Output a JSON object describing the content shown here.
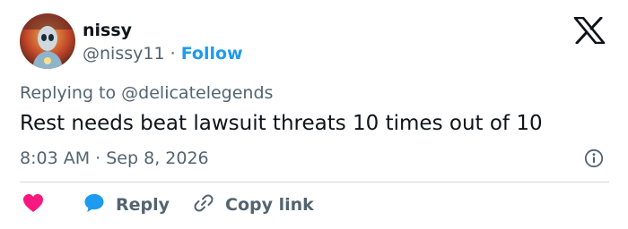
{
  "author": {
    "display_name": "nissy",
    "handle": "@nissy11",
    "separator": "·",
    "follow_label": "Follow"
  },
  "reply_context": {
    "prefix": "Replying to",
    "handle": "@delicatelegends"
  },
  "tweet": {
    "text": "Rest needs beat lawsuit threats 10 times out of 10",
    "time": "8:03 AM",
    "separator": "·",
    "date": "Sep 8, 2026"
  },
  "actions": {
    "like_icon": "heart-icon",
    "reply_label": "Reply",
    "reply_icon": "speech-bubble-icon",
    "copy_link_label": "Copy link",
    "copy_link_icon": "link-icon"
  },
  "colors": {
    "accent": "#1d9bf0",
    "like": "#f91880",
    "secondary_text": "#536471",
    "primary_text": "#0f1419",
    "divider": "#cfd9de"
  },
  "icons": {
    "brand": "x-logo-icon",
    "info": "info-icon",
    "avatar": "avatar-image"
  }
}
